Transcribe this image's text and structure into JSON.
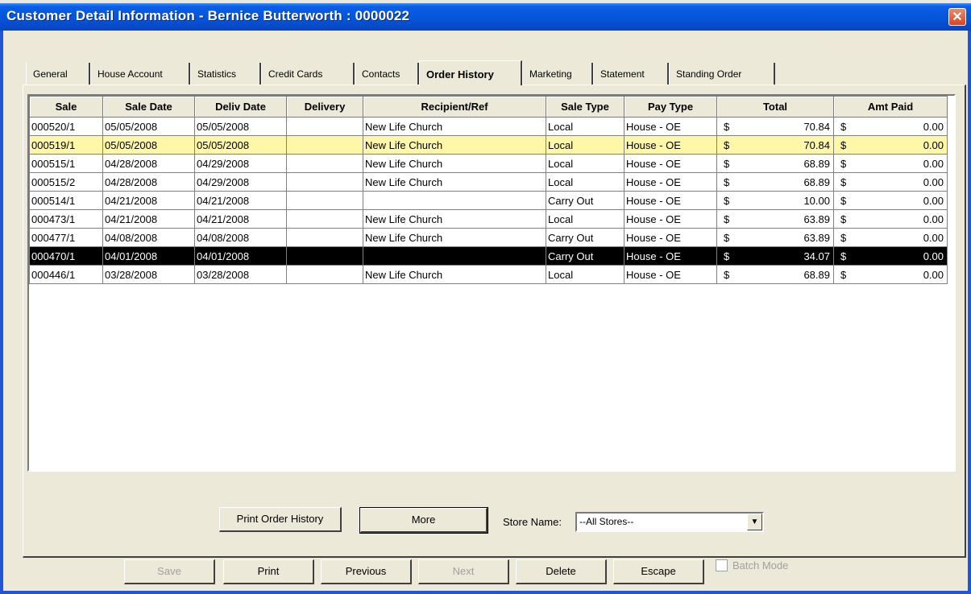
{
  "window": {
    "title": "Customer Detail Information - Bernice Butterworth : 0000022",
    "close_symbol": "✕"
  },
  "tabs": [
    "General",
    "House Account",
    "Statistics",
    "Credit Cards",
    "Contacts",
    "Order History",
    "Marketing",
    "Statement",
    "Standing Order"
  ],
  "active_tab": "Order History",
  "grid": {
    "columns": [
      "Sale",
      "Sale Date",
      "Deliv Date",
      "Delivery",
      "Recipient/Ref",
      "Sale Type",
      "Pay Type",
      "Total",
      "Amt Paid"
    ],
    "currency_symbol": "$",
    "rows": [
      {
        "sale": "000520/1",
        "sale_date": "05/05/2008",
        "deliv_date": "05/05/2008",
        "delivery": "",
        "recipient": "New Life Church",
        "sale_type": "Local",
        "pay_type": "House - OE",
        "total": "70.84",
        "amt_paid": "0.00",
        "highlight": ""
      },
      {
        "sale": "000519/1",
        "sale_date": "05/05/2008",
        "deliv_date": "05/05/2008",
        "delivery": "",
        "recipient": "New Life Church",
        "sale_type": "Local",
        "pay_type": "House - OE",
        "total": "70.84",
        "amt_paid": "0.00",
        "highlight": "yellow"
      },
      {
        "sale": "000515/1",
        "sale_date": "04/28/2008",
        "deliv_date": "04/29/2008",
        "delivery": "",
        "recipient": "New Life Church",
        "sale_type": "Local",
        "pay_type": "House - OE",
        "total": "68.89",
        "amt_paid": "0.00",
        "highlight": ""
      },
      {
        "sale": "000515/2",
        "sale_date": "04/28/2008",
        "deliv_date": "04/29/2008",
        "delivery": "",
        "recipient": "New Life Church",
        "sale_type": "Local",
        "pay_type": "House - OE",
        "total": "68.89",
        "amt_paid": "0.00",
        "highlight": ""
      },
      {
        "sale": "000514/1",
        "sale_date": "04/21/2008",
        "deliv_date": "04/21/2008",
        "delivery": "",
        "recipient": "",
        "sale_type": "Carry Out",
        "pay_type": "House - OE",
        "total": "10.00",
        "amt_paid": "0.00",
        "highlight": ""
      },
      {
        "sale": "000473/1",
        "sale_date": "04/21/2008",
        "deliv_date": "04/21/2008",
        "delivery": "",
        "recipient": "New Life Church",
        "sale_type": "Local",
        "pay_type": "House - OE",
        "total": "63.89",
        "amt_paid": "0.00",
        "highlight": ""
      },
      {
        "sale": "000477/1",
        "sale_date": "04/08/2008",
        "deliv_date": "04/08/2008",
        "delivery": "",
        "recipient": "New Life Church",
        "sale_type": "Carry Out",
        "pay_type": "House - OE",
        "total": "63.89",
        "amt_paid": "0.00",
        "highlight": ""
      },
      {
        "sale": "000470/1",
        "sale_date": "04/01/2008",
        "deliv_date": "04/01/2008",
        "delivery": "",
        "recipient": "",
        "sale_type": "Carry Out",
        "pay_type": "House - OE",
        "total": "34.07",
        "amt_paid": "0.00",
        "highlight": "black"
      },
      {
        "sale": "000446/1",
        "sale_date": "03/28/2008",
        "deliv_date": "03/28/2008",
        "delivery": "",
        "recipient": "New Life Church",
        "sale_type": "Local",
        "pay_type": "House - OE",
        "total": "68.89",
        "amt_paid": "0.00",
        "highlight": ""
      }
    ]
  },
  "panel_buttons": {
    "print_history": "Print Order History",
    "more": "More"
  },
  "store": {
    "label": "Store Name:",
    "selected": "--All Stores--"
  },
  "bottom_buttons": {
    "save": "Save",
    "print": "Print",
    "previous": "Previous",
    "next": "Next",
    "delete": "Delete",
    "escape": "Escape"
  },
  "batch_mode": {
    "label": "Batch Mode",
    "checked": false,
    "enabled": false
  },
  "colors": {
    "titlebar": "#0553d8",
    "face": "#ece9d8",
    "highlight_yellow": "#fff7a8",
    "selection_black": "#000000"
  }
}
